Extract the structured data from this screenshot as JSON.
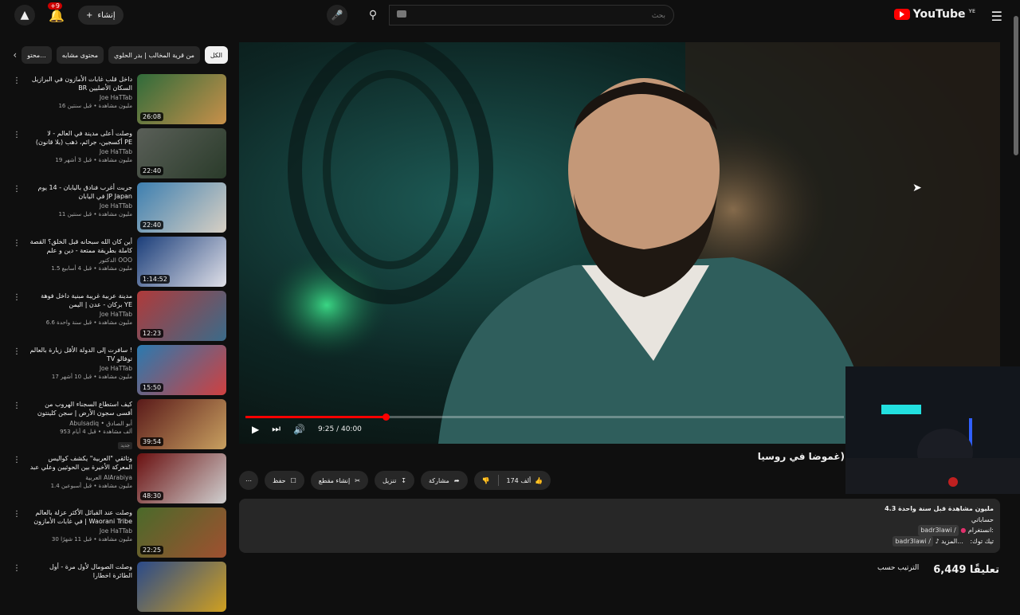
{
  "header": {
    "notif_count": "+9",
    "create_label": "إنشاء",
    "search_placeholder": "بحث",
    "logo_text": "YouTube",
    "region": "YE"
  },
  "chips": [
    {
      "label": "الكل",
      "active": true
    },
    {
      "label": "من قرية المخالب | بدر الحلوي"
    },
    {
      "label": "محتوى مشابه"
    },
    {
      "label": "محتو..."
    }
  ],
  "videos": [
    {
      "title": "داخل قلب غابات الأمازون في البرازيل BR السكان الأصليين",
      "channel": "Joe HaTTab",
      "stats": "16 مليون مشاهدة • قبل سنتين",
      "duration": "26:08",
      "colors": [
        "#2f6b3a",
        "#c8904a"
      ]
    },
    {
      "title": "وصلت أعلى مدينة في العالم - لا أكسجين، جرائم، ذهب (بلا قانون) PE",
      "channel": "Joe HaTTab",
      "stats": "19 مليون مشاهدة • قبل 3 أشهر",
      "duration": "22:40",
      "colors": [
        "#5a5f58",
        "#2a3b2a"
      ]
    },
    {
      "title": "جربت أغرب فنادق باليابان - 14 يوم في اليابان JP Japan",
      "channel": "Joe HaTTab",
      "stats": "11 مليون مشاهدة • قبل سنتين",
      "duration": "22:40",
      "colors": [
        "#3d7fb0",
        "#d8d0c4"
      ]
    },
    {
      "title": "أين كان الله سبحانه قبل الخلق؟ القصة كاملة بطريقة ممتعة - دين و علم",
      "channel": "الدكتور OOO",
      "stats": "1.5 مليون مشاهدة • قبل 4 أسابيع",
      "duration": "1:14:52",
      "colors": [
        "#1b3e7a",
        "#e0e0e8"
      ]
    },
    {
      "title": "مدينة عربية غريبة مبنية داخل فوهة بركان - عدن | اليمن YE",
      "channel": "Joe HaTTab",
      "stats": "6.6 مليون مشاهدة • قبل سنة واحدة",
      "duration": "12:23",
      "colors": [
        "#b03a3a",
        "#3a6b8a"
      ]
    },
    {
      "title": "سافرت إلى الدولة الأقل زيارة بالعالم ! TV توفالو",
      "channel": "Joe HaTTab",
      "stats": "17 مليون مشاهدة • قبل 10 أشهر",
      "duration": "15:50",
      "colors": [
        "#2a7ab0",
        "#d04040"
      ]
    },
    {
      "title": "كيف استطاع السجناء الهروب من أقسى سجون الأرض | سجن كلينتون من فيلم إلى حقيقة",
      "channel": "Abulsadiq • أبو الصادق",
      "stats": "953 ألف مشاهدة • قبل 4 أيام",
      "duration": "39:54",
      "colors": [
        "#5a1a1a",
        "#c8a060"
      ],
      "new": "جديد"
    },
    {
      "title": "وثائقي \"العربية\" يكشف كواليس المعركة الأخيرة بين الحوثيين وعلي عبد الله صالح",
      "channel": "العربية AlArabiya",
      "stats": "1.4 مليون مشاهدة • قبل أسبوعين",
      "duration": "48:30",
      "colors": [
        "#6a1010",
        "#d0d0d0"
      ]
    },
    {
      "title": "وصلت عند القبائل الأكثر عزلة بالعالم في غابات الأمازون | Waorani Tribe",
      "channel": "Joe HaTTab",
      "stats": "30 مليون مشاهدة • قبل 11 شهرًا",
      "duration": "22:25",
      "colors": [
        "#4a6a2a",
        "#a05030"
      ]
    },
    {
      "title": "وصلت الصومال لأول مرة - أول الطائرة اخطارا",
      "channel": "",
      "stats": "",
      "duration": "",
      "colors": [
        "#2a4a8a",
        "#d0a020"
      ]
    }
  ],
  "player": {
    "time": "9:25 / 40:00",
    "progress": 0.235
  },
  "video": {
    "title": "غموضا في روسيا)"
  },
  "actions": {
    "likes": "174 ألف",
    "share": "مشاركة",
    "download": "تنزيل",
    "clip": "إنشاء مقطع",
    "save": "حفظ"
  },
  "description": {
    "views": "4.3 مليون مشاهدة قبل سنة واحدة",
    "line2": "حساباتي",
    "instagram": "انستغرام:",
    "ig_handle": "badr3lawi /",
    "tiktok": "تيك توك:",
    "tt_handle": "badr3lawi /",
    "more": "...المزيد"
  },
  "comments": {
    "count": "6,449 تعليقًا",
    "sort": "الترتيب حسب"
  }
}
